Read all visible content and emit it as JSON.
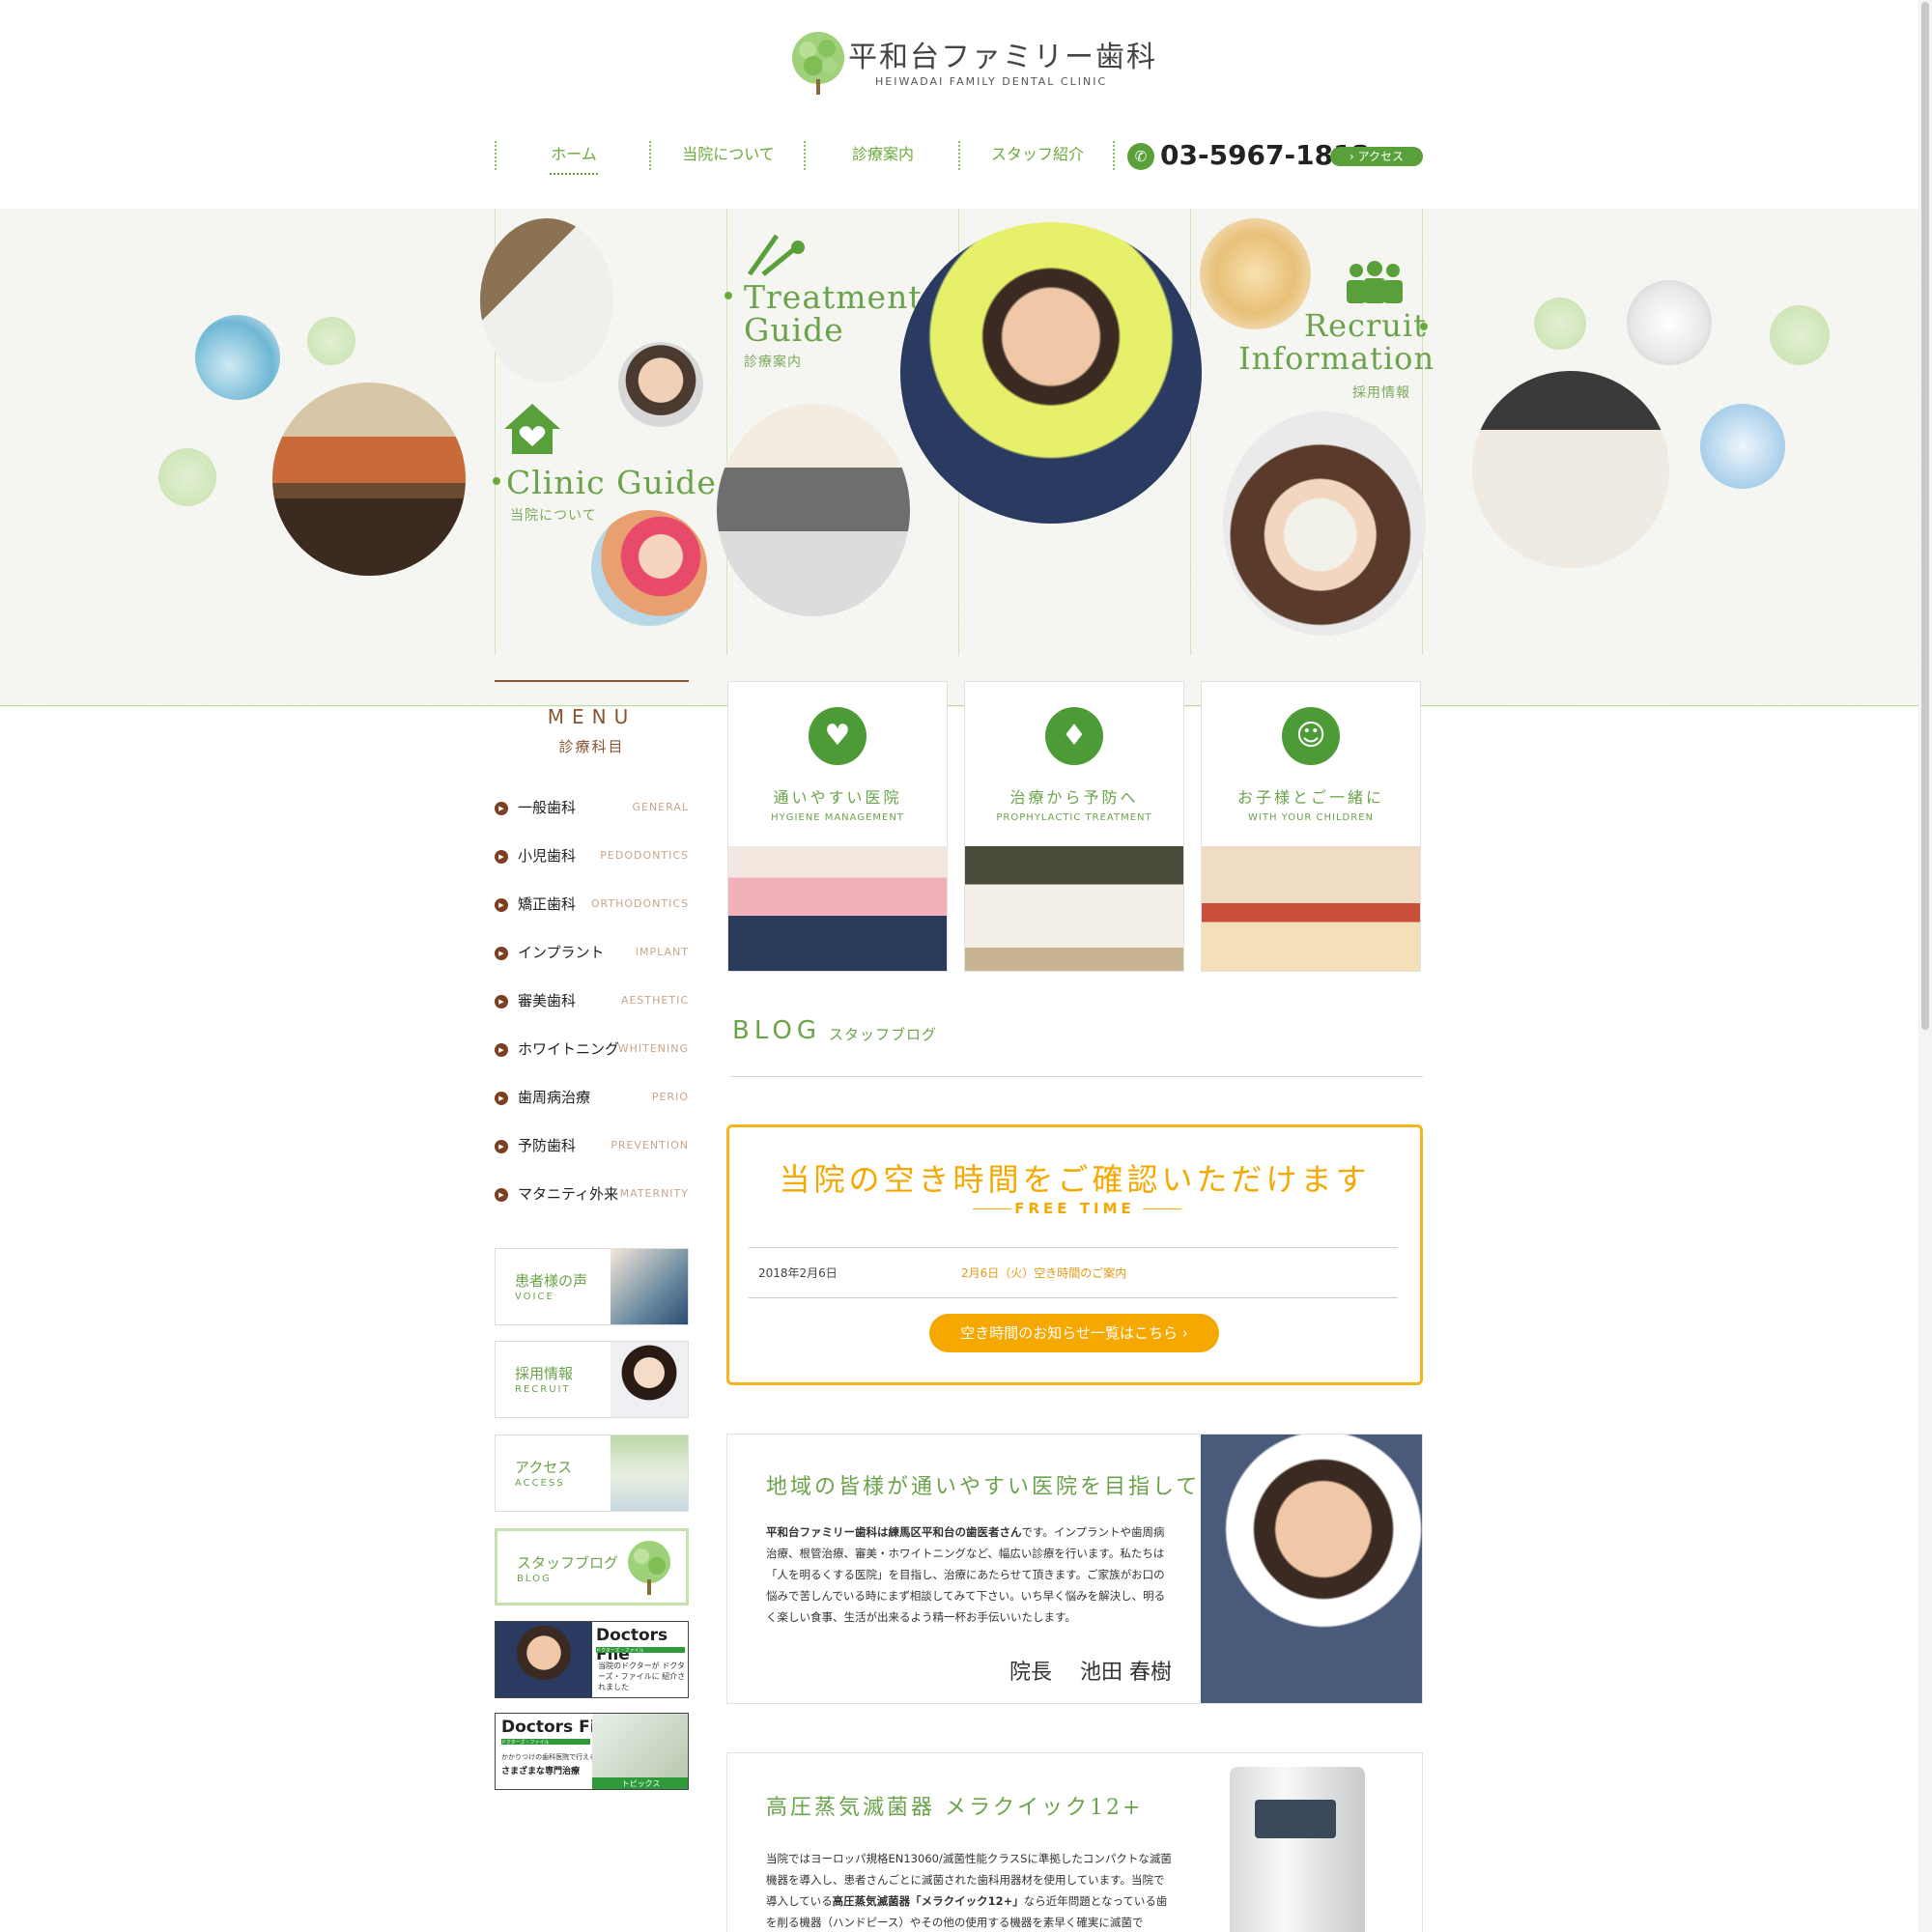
{
  "header": {
    "logo_title": "平和台ファミリー歯科",
    "logo_sub": "HEIWADAI FAMILY DENTAL CLINIC",
    "nav": [
      "ホーム",
      "当院について",
      "診療案内",
      "スタッフ紹介"
    ],
    "phone": "03-5967-1812",
    "access_label": "› アクセス"
  },
  "hero": {
    "clinic_title": "Clinic Guide",
    "clinic_sub": "当院について",
    "treatment_title_1": "Treatment",
    "treatment_title_2": "Guide",
    "treatment_sub": "診療案内",
    "recruit_title_1": "Recruit",
    "recruit_title_2": "Information",
    "recruit_sub": "採用情報"
  },
  "menu": {
    "title": "MENU",
    "subtitle": "診療科目",
    "items": [
      {
        "jp": "一般歯科",
        "en": "GENERAL"
      },
      {
        "jp": "小児歯科",
        "en": "PEDODONTICS"
      },
      {
        "jp": "矯正歯科",
        "en": "ORTHODONTICS"
      },
      {
        "jp": "インプラント",
        "en": "IMPLANT"
      },
      {
        "jp": "審美歯科",
        "en": "AESTHETIC"
      },
      {
        "jp": "ホワイトニング",
        "en": "WHITENING"
      },
      {
        "jp": "歯周病治療",
        "en": "PERIO"
      },
      {
        "jp": "予防歯科",
        "en": "PREVENTION"
      },
      {
        "jp": "マタニティ外来",
        "en": "MATERNITY"
      }
    ]
  },
  "side_cards": [
    {
      "jp": "患者様の声",
      "en": "VOICE"
    },
    {
      "jp": "採用情報",
      "en": "RECRUIT"
    },
    {
      "jp": "アクセス",
      "en": "ACCESS"
    },
    {
      "jp": "スタッフブログ",
      "en": "BLOG"
    }
  ],
  "doctors_file_1": {
    "title": "Doctors File",
    "sub": "ドクターズ・ファイル",
    "text": "当院のドクターが ドクターズ・ファイルに 紹介されました"
  },
  "doctors_file_2": {
    "title": "Doctors File",
    "sub": "ドクターズ・ファイル",
    "text_1": "かかりつけの歯科医院で行える",
    "text_2": "さまざまな専門治療",
    "tag": "トピックス"
  },
  "features": [
    {
      "jp": "通いやすい医院",
      "en": "HYGIENE MANAGEMENT",
      "icon": "♥"
    },
    {
      "jp": "治療から予防へ",
      "en": "PROPHYLACTIC TREATMENT",
      "icon": "♦"
    },
    {
      "jp": "お子様とご一緒に",
      "en": "WITH YOUR CHILDREN",
      "icon": "☺"
    }
  ],
  "blog": {
    "title": "BLOG",
    "sub": "スタッフブログ"
  },
  "free_time": {
    "title": "当院の空き時間をご確認いただけます",
    "sub": "FREE TIME",
    "date": "2018年2月6日",
    "link": "2月6日（火）空き時間のご案内",
    "button": "空き時間のお知らせ一覧はこちら ›"
  },
  "intro": {
    "title": "地域の皆様が通いやすい医院を目指して",
    "text_bold": "平和台ファミリー歯科は練馬区平和台の歯医者さん",
    "text": "です。インプラントや歯周病治療、根管治療、審美・ホワイトニングなど、幅広い診療を行います。私たちは「人を明るくする医院」を目指し、治療にあたらせて頂きます。ご家族がお口の悩みで苦しんでいる時にまず相談してみて下さい。いち早く悩みを解決し、明るく楽しい食事、生活が出来るよう精一杯お手伝いいたします。",
    "signature": "院長　 池田 春樹"
  },
  "sterilizer": {
    "title": "高圧蒸気滅菌器 メラクイック12+",
    "text_1": "当院ではヨーロッパ規格EN13060/滅菌性能クラスSに準拠したコンパクトな滅菌機器を導入し、患者さんごとに滅菌された歯科用器材を使用しています。当院で導入している",
    "text_bold": "高圧蒸気滅菌器「メラクイック12+」",
    "text_2": "なら近年問題となっている歯を削る機器（ハンドピース）やその他の使用する機器を素早く確実に滅菌で"
  },
  "colors": {
    "brand_green": "#6aa34a",
    "accent_orange": "#f5a800",
    "menu_brown": "#8a5530"
  }
}
